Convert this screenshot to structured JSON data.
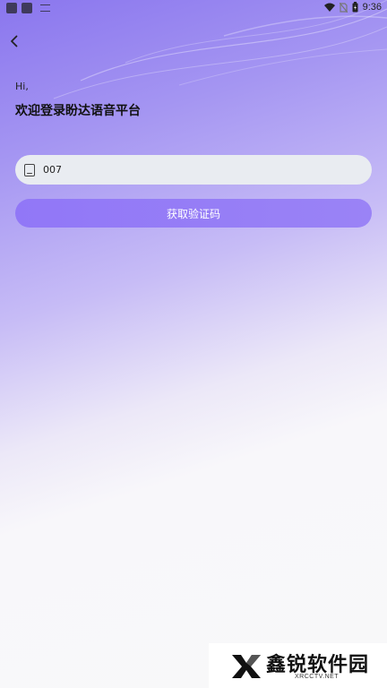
{
  "status_bar": {
    "time": "9:36"
  },
  "header": {
    "greeting": "Hi,",
    "welcome": "欢迎登录盼达语音平台"
  },
  "form": {
    "phone_value": "007",
    "get_code_label": "获取验证码"
  },
  "watermark": {
    "name": "鑫锐软件园",
    "url": "XRCCTV.NET"
  },
  "colors": {
    "accent": "#9177f7",
    "field_bg": "#e9ecf1"
  }
}
